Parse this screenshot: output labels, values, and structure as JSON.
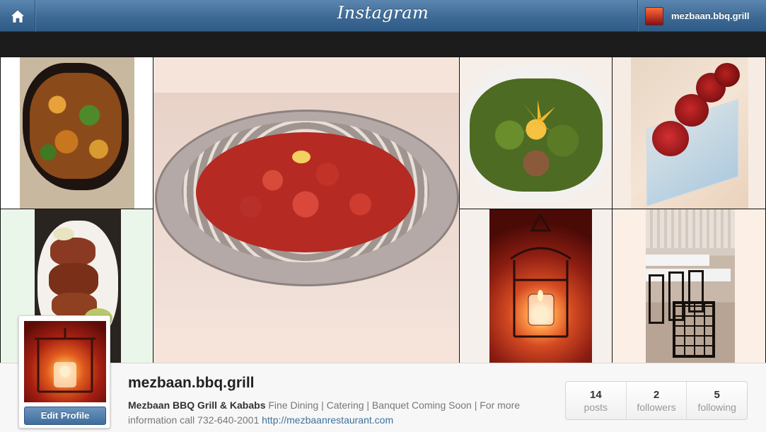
{
  "header": {
    "logo_text": "Instagram",
    "username": "mezbaan.bbq.grill"
  },
  "icons": {
    "home": "home-icon"
  },
  "grid": {
    "tiles": [
      {
        "name": "photo-paneer-tikka"
      },
      {
        "name": "photo-chicken-platter"
      },
      {
        "name": "photo-salad"
      },
      {
        "name": "photo-roses"
      },
      {
        "name": "photo-kababs"
      },
      {
        "name": "photo-lantern"
      },
      {
        "name": "photo-dining-room"
      }
    ]
  },
  "profile": {
    "username": "mezbaan.bbq.grill",
    "edit_label": "Edit Profile",
    "bio_name": "Mezbaan BBQ Grill & Kababs",
    "bio_text": " Fine Dining | Catering | Banquet Coming Soon | For more information call 732-640-2001 ",
    "website": "http://mezbaanrestaurant.com"
  },
  "stats": [
    {
      "value": "14",
      "label": "posts"
    },
    {
      "value": "2",
      "label": "followers"
    },
    {
      "value": "5",
      "label": "following"
    }
  ],
  "colors": {
    "header_blue": "#3d6a95",
    "link_blue": "#3f729b"
  }
}
